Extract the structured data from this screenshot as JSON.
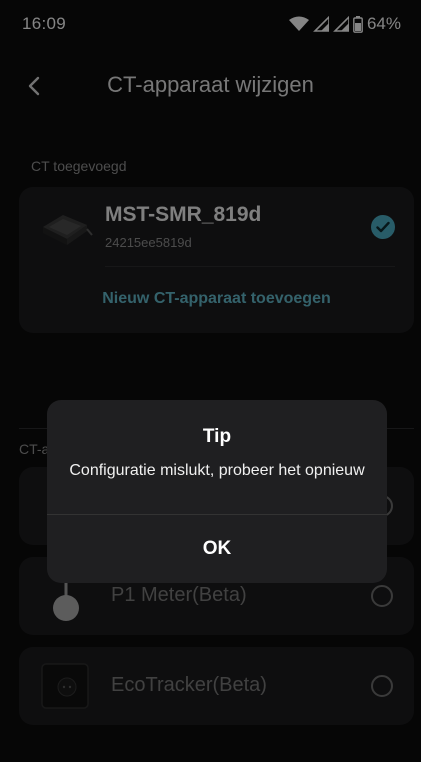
{
  "status": {
    "time": "16:09",
    "battery": "64%"
  },
  "header": {
    "title": "CT-apparaat wijzigen"
  },
  "added": {
    "label": "CT toegevoegd",
    "device_name": "MST-SMR_819d",
    "device_id": "24215ee5819d",
    "add_link": "Nieuw CT-apparaat toevoegen"
  },
  "available": {
    "label_partial": "CT-a",
    "options": [
      {
        "label": ""
      },
      {
        "label": "P1 Meter(Beta)"
      },
      {
        "label": "EcoTracker(Beta)"
      }
    ]
  },
  "dialog": {
    "title": "Tip",
    "message": "Configuratie mislukt, probeer het opnieuw",
    "ok_label": "OK"
  },
  "colors": {
    "accent": "#4aa8bd",
    "link": "#5fb3c4",
    "card": "#1b1b1d"
  }
}
